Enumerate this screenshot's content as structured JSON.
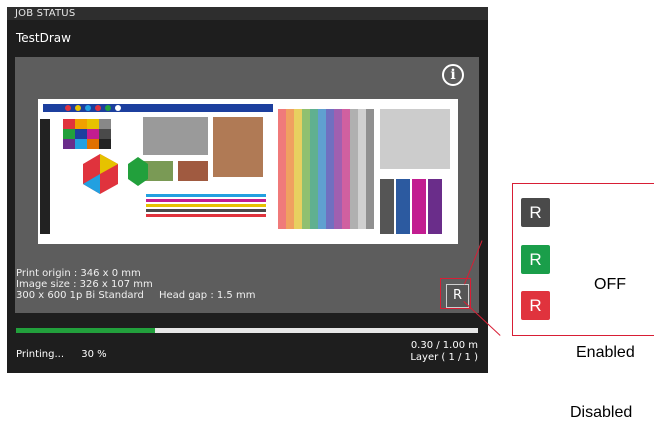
{
  "panel": {
    "header": "JOB STATUS",
    "job_name": "TestDraw",
    "info_icon": "info-icon",
    "meta": {
      "origin": "Print origin : 346 x 0 mm",
      "size": "Image size : 326 x 107 mm",
      "mode": "300 x 600 1p Bi Standard",
      "gap": "Head gap : 1.5 mm"
    },
    "r_button": "R",
    "progress": {
      "fraction": 0.3,
      "status": "Printing...",
      "percent": "30 %",
      "distance": "0.30 / 1.00 m",
      "layer": "Layer ( 1 / 1 )"
    }
  },
  "legend": {
    "buttons": [
      {
        "label": "R",
        "color": "#4a4a4a"
      },
      {
        "label": "R",
        "color": "#1a9e4a"
      },
      {
        "label": "R",
        "color": "#e0333d"
      }
    ],
    "off": "OFF",
    "enabled": "Enabled",
    "disabled": "Disabled"
  },
  "colors": {
    "accent_red": "#d81e35",
    "progress_green": "#22a03c"
  }
}
